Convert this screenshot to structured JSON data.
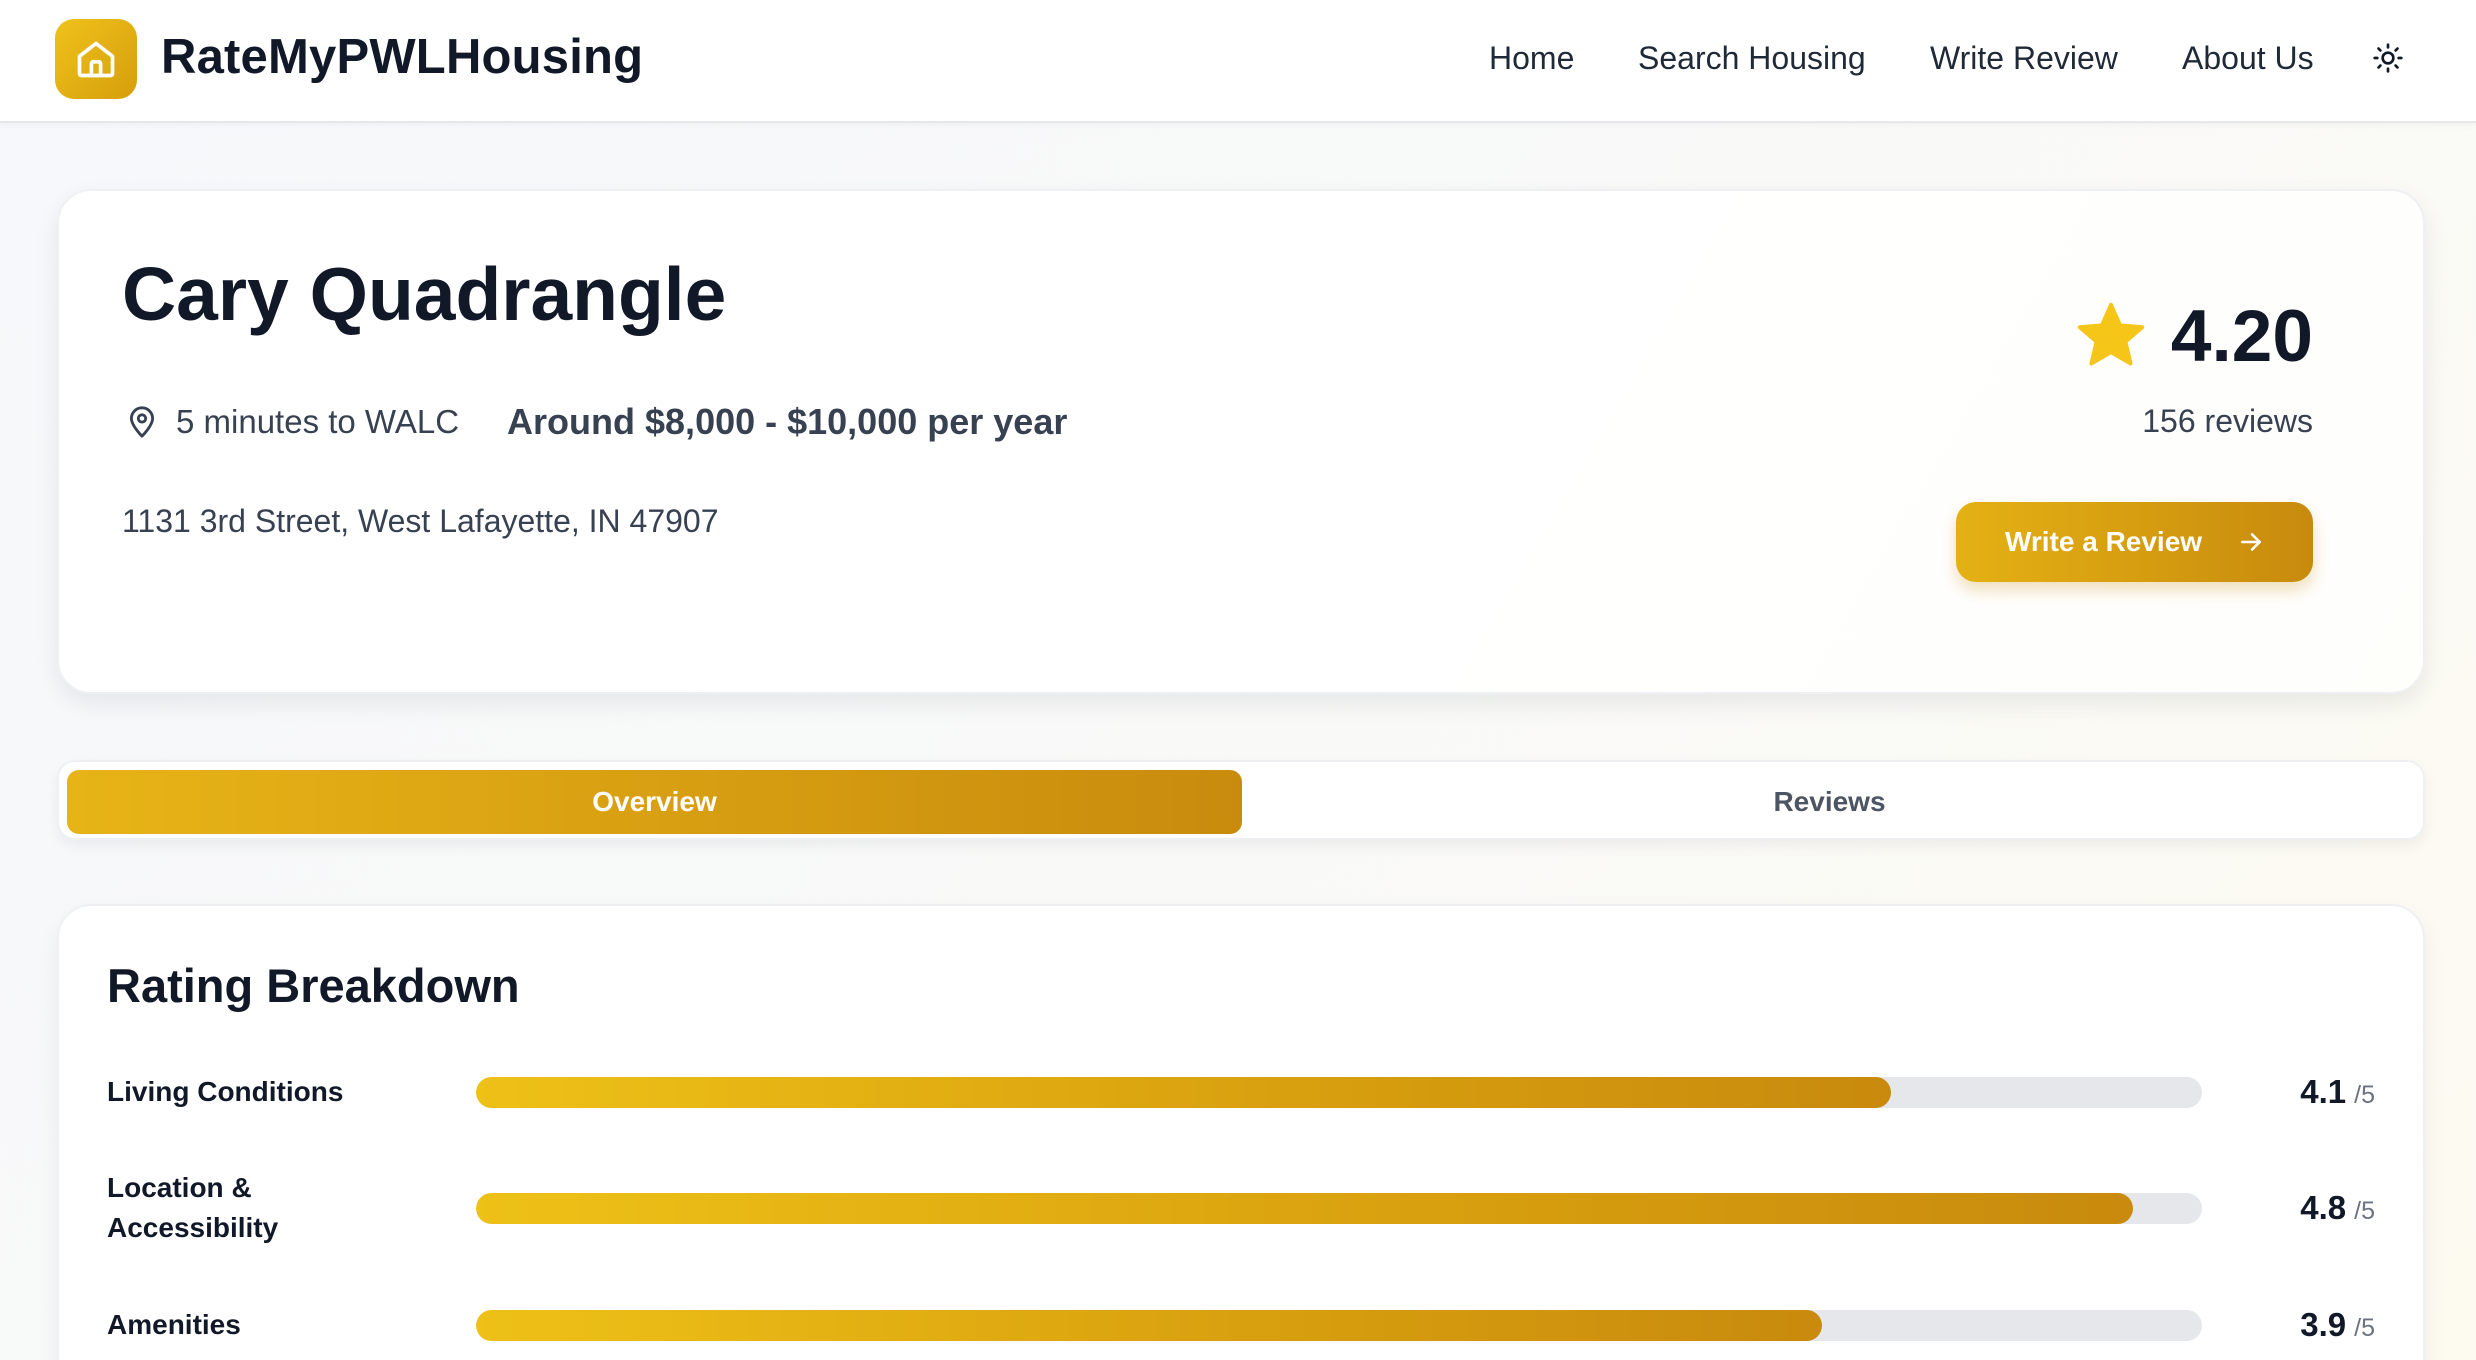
{
  "header": {
    "brand": "RateMyPWLHousing",
    "nav": {
      "home": "Home",
      "search": "Search Housing",
      "write": "Write Review",
      "about": "About Us"
    },
    "icons": {
      "logo": "house-icon",
      "theme": "sun-icon"
    }
  },
  "property": {
    "name": "Cary Quadrangle",
    "walk_time": "5 minutes to WALC",
    "price": "Around $8,000 - $10,000 per year",
    "address": "1131 3rd Street, West Lafayette, IN 47907",
    "rating": "4.20",
    "review_count": "156 reviews",
    "write_button": "Write a Review"
  },
  "tabs": {
    "overview": "Overview",
    "reviews": "Reviews",
    "active": "Overview"
  },
  "breakdown": {
    "title": "Rating Breakdown",
    "max_label": "/5",
    "rows": [
      {
        "label": "Living Conditions",
        "score": "4.1",
        "value": 4.1
      },
      {
        "label": "Location & Accessibility",
        "score": "4.8",
        "value": 4.8
      },
      {
        "label": "Amenities",
        "score": "3.9",
        "value": 3.9
      }
    ]
  },
  "colors": {
    "accent_start": "#e7b417",
    "accent_end": "#c98b0d",
    "star": "#f5c518",
    "track": "#e5e7eb"
  }
}
